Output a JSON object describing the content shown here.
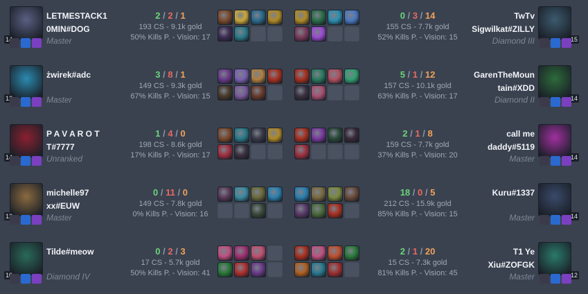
{
  "rows": [
    {
      "left": {
        "name": "LETMESTACK1 0MIN#DOG",
        "rank": "Master",
        "level": "14",
        "kills": "2",
        "deaths": "2",
        "assists": "1",
        "cs": "193 CS - 9.1k gold",
        "kp": "50% Kills P. - Vision: 17",
        "color": "#5a5f82"
      },
      "right": {
        "name": "TwTv Sigwilkat#ZILLY",
        "rank": "Diamond III",
        "level": "15",
        "kills": "0",
        "deaths": "3",
        "assists": "14",
        "cs": "155 CS - 7.7k gold",
        "kp": "52% Kills P. - Vision: 15",
        "color": "#3c5a6e"
      },
      "items_l": [
        "#7b4a2c",
        "#c9a83a",
        "#2b6a8c",
        "#b08a26",
        "#3e2c54",
        "#2a7a8a",
        "#4a5261",
        "#4a5261"
      ],
      "items_r": [
        "#b08a26",
        "#2a6e4a",
        "#2d8fb0",
        "#4a78c0",
        "#7a3a5a",
        "#9a4ad0",
        "#4a5261",
        "#4a5261"
      ]
    },
    {
      "left": {
        "name": "żwirek#adc",
        "rank": "Master",
        "level": "12",
        "kills": "3",
        "deaths": "8",
        "assists": "1",
        "cs": "149 CS - 9.3k gold",
        "kp": "67% Kills P. - Vision: 15",
        "color": "#2b8ab0"
      },
      "right": {
        "name": "GarenTheMoun tain#XDD",
        "rank": "Diamond II",
        "level": "14",
        "kills": "5",
        "deaths": "1",
        "assists": "12",
        "cs": "157 CS - 10.1k gold",
        "kp": "63% Kills P. - Vision: 17",
        "color": "#2d6b3a"
      },
      "items_l": [
        "#6a3a8a",
        "#7a60b0",
        "#b08040",
        "#a83020",
        "#4a3a2a",
        "#7a5a9a",
        "#6a3a2a",
        "#4a5261"
      ],
      "items_r": [
        "#a83020",
        "#2a7a60",
        "#b05060",
        "#30a070",
        "#3a3040",
        "#a85070",
        "#4a5261",
        "#4a5261"
      ]
    },
    {
      "left": {
        "name": "P A V A R O T T#7777",
        "rank": "Unranked",
        "level": "14",
        "kills": "1",
        "deaths": "4",
        "assists": "0",
        "cs": "198 CS - 8.6k gold",
        "kp": "17% Kills P. - Vision: 17",
        "color": "#8a2030"
      },
      "right": {
        "name": "call me daddy#5119",
        "rank": "Master",
        "level": "14",
        "kills": "2",
        "deaths": "1",
        "assists": "8",
        "cs": "159 CS - 7.7k gold",
        "kp": "37% Kills P. - Vision: 20",
        "color": "#a030a0"
      },
      "items_l": [
        "#7b4a2c",
        "#2a7a8a",
        "#3a3a4a",
        "#b08a26",
        "#a03040",
        "#3a3040",
        "#4a5261",
        "#4a5261"
      ],
      "items_r": [
        "#a83020",
        "#7a3aa0",
        "#2a4a3a",
        "#3a2a3a",
        "#a03040",
        "#4a5261",
        "#4a5261",
        "#4a5261"
      ]
    },
    {
      "left": {
        "name": "michelle97 xx#EUW",
        "rank": "Master",
        "level": "12",
        "kills": "0",
        "deaths": "11",
        "assists": "0",
        "cs": "149 CS - 7.8k gold",
        "kp": "0% Kills P. - Vision: 16",
        "color": "#8a6a40"
      },
      "right": {
        "name": "Kuru#1337",
        "rank": "Master",
        "level": "14",
        "kills": "18",
        "deaths": "0",
        "assists": "5",
        "cs": "212 CS - 15.9k gold",
        "kp": "85% Kills P. - Vision: 15",
        "color": "#3a4a6a"
      },
      "items_l": [
        "#5a3a5a",
        "#3a8aa0",
        "#6a6a3a",
        "#2a80b0",
        "#4a5261",
        "#4a5261",
        "#3a4a3a",
        "#4a5261"
      ],
      "items_r": [
        "#2a80b0",
        "#7a6a40",
        "#7a8a40",
        "#6a4a3a",
        "#5a3a6a",
        "#4a6a3a",
        "#a83020",
        "#4a5261"
      ]
    },
    {
      "left": {
        "name": "Tilde#meow",
        "rank": "Diamond IV",
        "level": "10",
        "kills": "0",
        "deaths": "2",
        "assists": "3",
        "cs": "17 CS - 5.7k gold",
        "kp": "50% Kills P. - Vision: 41",
        "color": "#2a6a5a"
      },
      "right": {
        "name": "T1 Ye Xiu#ZOFGK",
        "rank": "Master",
        "level": "12",
        "kills": "2",
        "deaths": "1",
        "assists": "20",
        "cs": "15 CS - 7.3k gold",
        "kp": "81% Kills P. - Vision: 45",
        "color": "#2a7a6a"
      },
      "items_l": [
        "#c05080",
        "#a03070",
        "#c05070",
        "#4a5261",
        "#2a7a3a",
        "#b03030",
        "#6a3a8a",
        "#4a5261"
      ],
      "items_r": [
        "#a83020",
        "#c05080",
        "#c05030",
        "#2a7a3a",
        "#b06020",
        "#2a7a90",
        "#a03030",
        "#4a5261"
      ]
    }
  ],
  "spells": {
    "flash": "#2a6ad0",
    "smite": "#d0a020",
    "teleport": "#7a40c0",
    "ignite": "#e05020",
    "heal": "#30c070",
    "exhaust": "#c07020",
    "rune": "#3a3a4a"
  }
}
